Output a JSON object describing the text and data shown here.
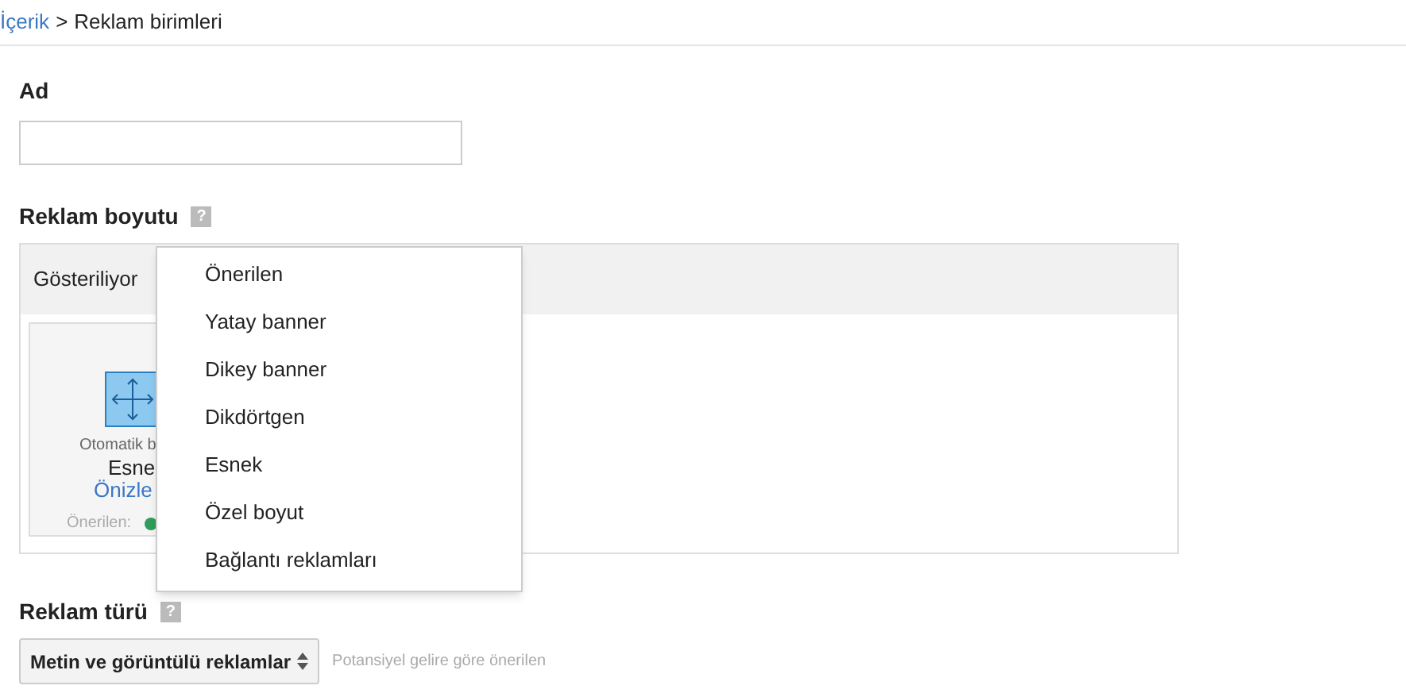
{
  "breadcrumb": {
    "link": "İçerik",
    "separator": ">",
    "current": "Reklam birimleri"
  },
  "name_field": {
    "label": "Ad"
  },
  "ad_size": {
    "label": "Reklam boyutu",
    "help": "?",
    "tab_label": "Gösteriliyor",
    "card": {
      "caption": "Otomatik b",
      "title": "Esne",
      "link": "Önizle",
      "recommended": "Önerilen:"
    },
    "menu": [
      "Önerilen",
      "Yatay banner",
      "Dikey banner",
      "Dikdörtgen",
      "Esnek",
      "Özel boyut",
      "Bağlantı reklamları"
    ]
  },
  "ad_type": {
    "label": "Reklam türü",
    "help": "?",
    "value": "Metin ve görüntülü reklamlar",
    "hint": "Potansiyel gelire göre önerilen"
  }
}
